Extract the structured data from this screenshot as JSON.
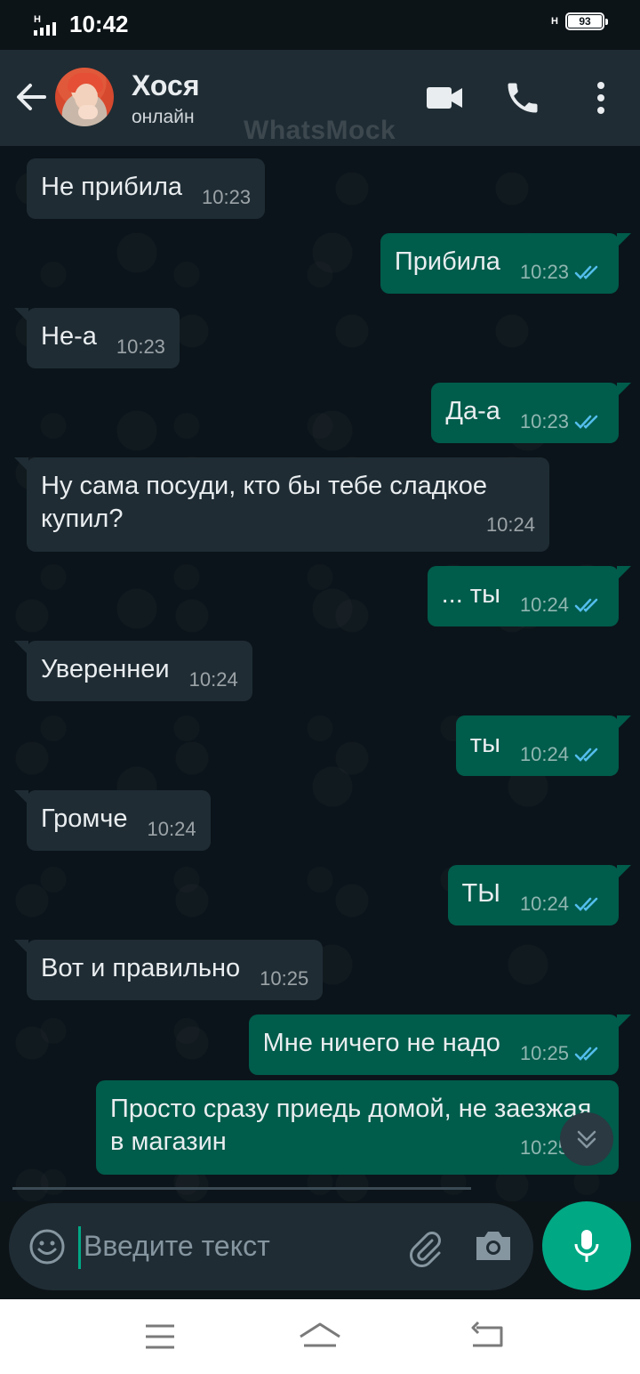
{
  "status_bar": {
    "signal_label": "H",
    "time": "10:42",
    "network_label": "H",
    "battery": "93"
  },
  "header": {
    "contact_name": "Хося",
    "contact_status": "онлайн",
    "watermark": "WhatsMock",
    "icons": [
      "back-arrow-icon",
      "video-camera-icon",
      "phone-icon",
      "more-vertical-icon"
    ]
  },
  "messages": [
    {
      "direction": "in",
      "text": "Не прибила",
      "time": "10:23"
    },
    {
      "direction": "out",
      "text": "Прибила",
      "time": "10:23",
      "read": true
    },
    {
      "direction": "in",
      "text": "Не-а",
      "time": "10:23"
    },
    {
      "direction": "out",
      "text": "Да-а",
      "time": "10:23",
      "read": true
    },
    {
      "direction": "in",
      "text": "Ну сама посуди, кто бы тебе сладкое купил?",
      "time": "10:24"
    },
    {
      "direction": "out",
      "text": "... ты",
      "time": "10:24",
      "read": true
    },
    {
      "direction": "in",
      "text": "Увереннеи",
      "time": "10:24"
    },
    {
      "direction": "out",
      "text": "ты",
      "time": "10:24",
      "read": true
    },
    {
      "direction": "in",
      "text": "Громче",
      "time": "10:24"
    },
    {
      "direction": "out",
      "text": "ТЫ",
      "time": "10:24",
      "read": true
    },
    {
      "direction": "in",
      "text": "Вот и правильно",
      "time": "10:25"
    },
    {
      "direction": "out",
      "text": "Мне ничего не надо",
      "time": "10:25",
      "read": true
    },
    {
      "direction": "out",
      "text": "Просто сразу приедь домой, не заезжая в магазин",
      "time": "10:25",
      "read": true
    }
  ],
  "input": {
    "placeholder": "Введите текст",
    "value": ""
  },
  "colors": {
    "incoming_bubble": "#1f2c34",
    "outgoing_bubble": "#005c4b",
    "accent": "#00a884",
    "read_tick": "#53bdeb",
    "background": "#0b141a"
  }
}
